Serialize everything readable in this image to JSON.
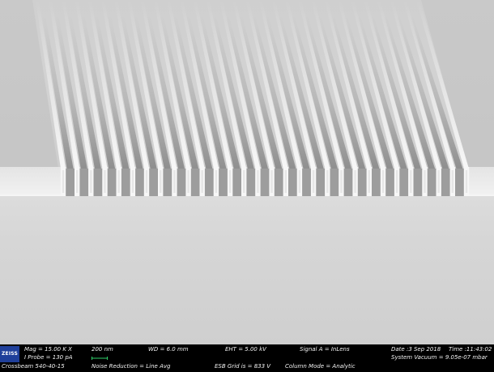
{
  "logo_text": "ZEISS",
  "fields": {
    "mag": "Mag =   15.00 K X",
    "iprobe": "I Probe =   130 pA",
    "instrument": "Crossbeam 540-40-15",
    "scale": "200 nm",
    "noise": "Noise Reduction = Line Avg",
    "wd": "WD =   6.0 mm",
    "eht": "EHT =   5.00 kV",
    "esb": "ESB Grid is =   833 V",
    "signal": "Signal A = InLens",
    "column": "Column Mode = Analytic",
    "date": "Date :3 Sep 2018",
    "time": "Time :11:43:02",
    "vacuum": "System Vacuum = 9.05e-07 mbar"
  },
  "colors": {
    "scale_bar": "#2fd16a",
    "logo_bg": "#1f3f9a",
    "databar_bg": "#000000",
    "databar_text": "#f2f2f2"
  }
}
